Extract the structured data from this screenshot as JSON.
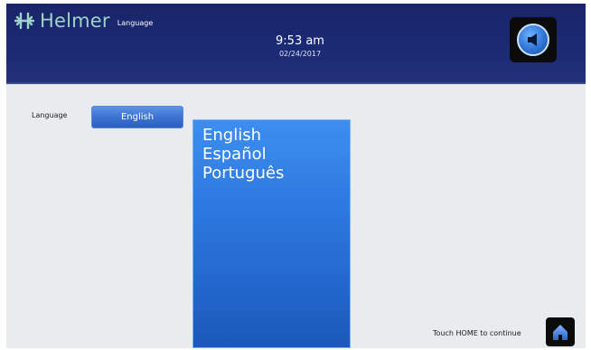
{
  "header": {
    "brand_name": "Helmer",
    "section_title": "Language",
    "time": "9:53 am",
    "date": "02/24/2017"
  },
  "settings": {
    "language_label": "Language",
    "selected_language": "English"
  },
  "language_options": [
    "English",
    "Español",
    "Português"
  ],
  "footer": {
    "prompt": "Touch HOME to continue"
  },
  "icons": {
    "logo": "helmer-logo-icon",
    "sound": "speaker-icon",
    "home": "home-icon"
  },
  "colors": {
    "header_bg": "#1b2a74",
    "brand_text": "#9fd3c7",
    "accent_blue": "#2d78df",
    "panel_bg": "#e9ecef"
  }
}
